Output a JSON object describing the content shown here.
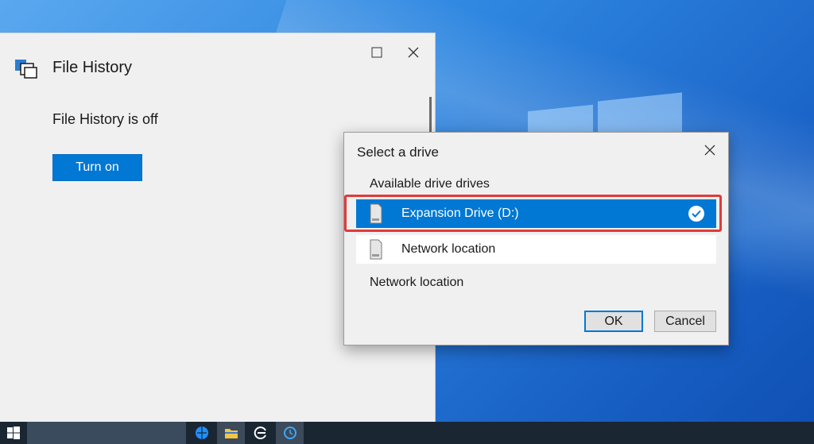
{
  "file_history": {
    "title": "File History",
    "status": "File History is off",
    "turn_on_label": "Turn on",
    "maximize_glyph": "☐",
    "close_glyph": "✕"
  },
  "select_drive_dialog": {
    "title": "Select a drive",
    "close_glyph": "✕",
    "subheading": "Available drive drives",
    "drives": [
      {
        "label": "Expansion Drive (D:)",
        "selected": true,
        "icon": "drive-icon"
      },
      {
        "label": "Network location",
        "selected": false,
        "icon": "drive-icon"
      }
    ],
    "network_location_link": "Network location",
    "ok_label": "OK",
    "cancel_label": "Cancel"
  },
  "taskbar": {
    "items": [
      "start-icon",
      "search-box",
      "edge-icon",
      "file-explorer-icon",
      "browser-icon",
      "file-history-icon"
    ]
  },
  "colors": {
    "accent": "#0078d4",
    "highlight_border": "#e03a3a",
    "taskbar": "#1b2633"
  }
}
